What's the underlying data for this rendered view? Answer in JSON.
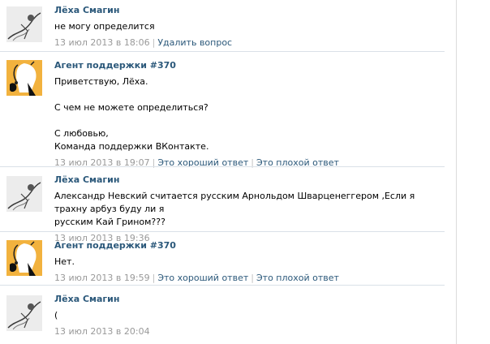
{
  "messages": [
    {
      "author": "Лёха Смагин",
      "role": "user",
      "text": "не могу определится",
      "date": "13 июл 2013 в 18:06",
      "actions": [
        "Удалить вопрос"
      ]
    },
    {
      "author": "Агент поддержки #370",
      "role": "agent",
      "text": "Приветствую, Лёха.\n\nС чем не можете определиться?\n\nС любовью,\nКоманда поддержки ВКонтакте.",
      "date": "13 июл 2013 в 19:07",
      "actions": [
        "Это хороший ответ",
        "Это плохой ответ"
      ]
    },
    {
      "author": "Лёха Смагин",
      "role": "user",
      "text": "Александр Невский считается русским Арнольдом Шварценеггером ,Если я трахну арбуз буду ли я\nрусским Кай Грином???",
      "date": "13 июл 2013 в 19:36",
      "actions": []
    },
    {
      "author": "Агент поддержки #370",
      "role": "agent",
      "text": "Нет.",
      "date": "13 июл 2013 в 19:59",
      "actions": [
        "Это хороший ответ",
        "Это плохой ответ"
      ]
    },
    {
      "author": "Лёха Смагин",
      "role": "user",
      "text": "(",
      "date": "13 июл 2013 в 20:04",
      "actions": []
    }
  ]
}
